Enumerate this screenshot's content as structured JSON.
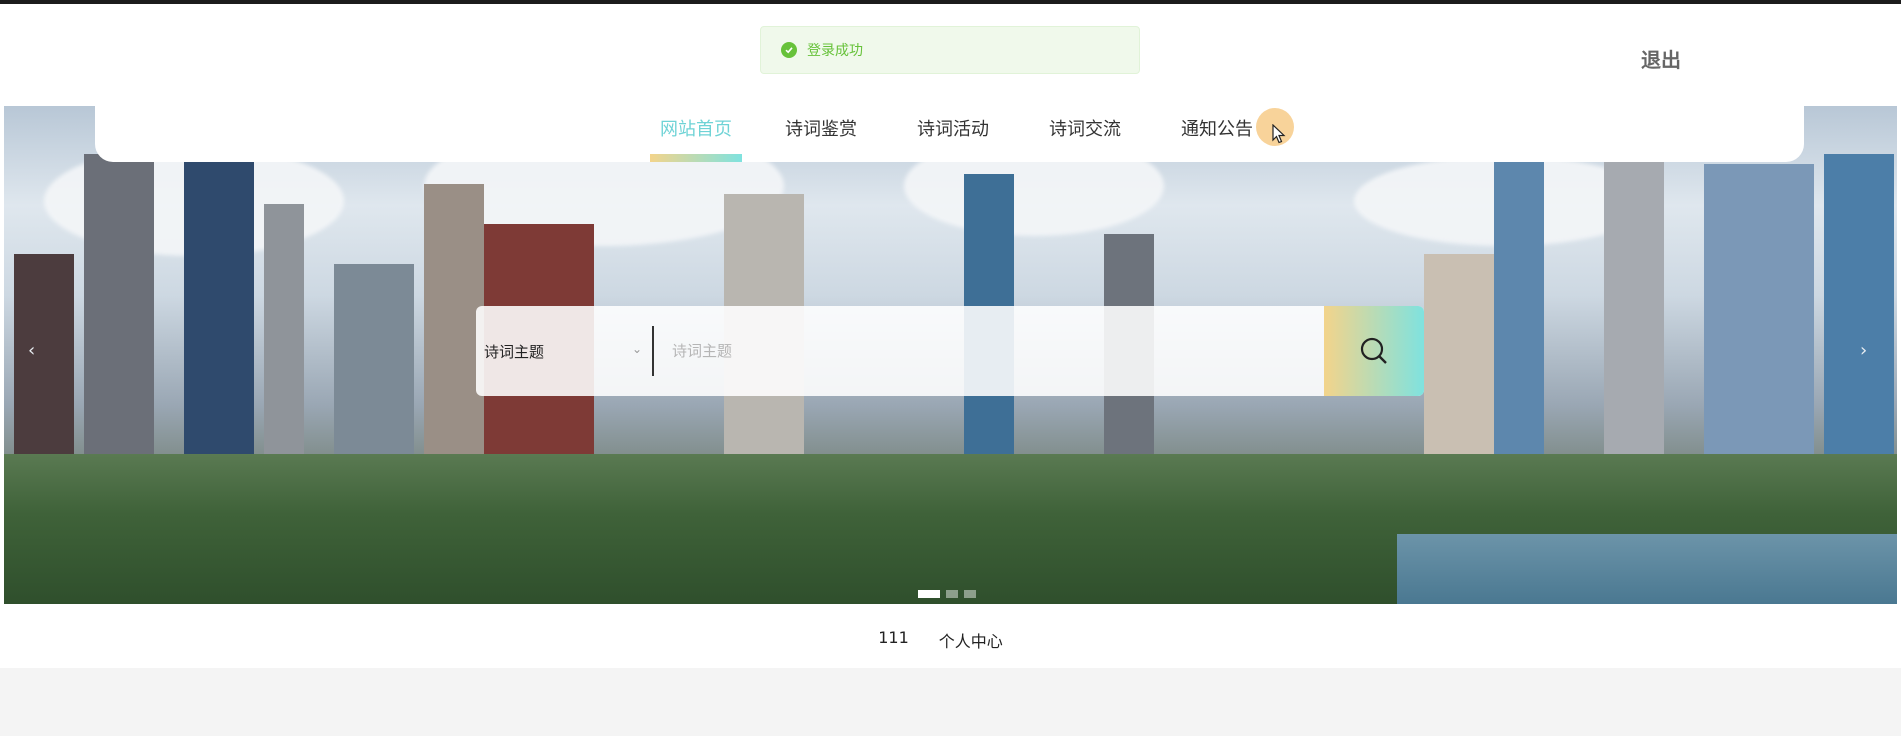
{
  "toast": {
    "message": "登录成功",
    "icon": "check-circle-icon",
    "color": "#67c23a"
  },
  "header": {
    "logout_label": "退出"
  },
  "nav": {
    "items": [
      {
        "label": "网站首页",
        "active": true
      },
      {
        "label": "诗词鉴赏",
        "active": false
      },
      {
        "label": "诗词活动",
        "active": false
      },
      {
        "label": "诗词交流",
        "active": false
      },
      {
        "label": "通知公告",
        "active": false
      }
    ],
    "accent_gradient": [
      "#f3d48b",
      "#7fe2df"
    ],
    "active_color": "#6fd3d6"
  },
  "search": {
    "category_selected": "诗词主题",
    "placeholder": "诗词主题",
    "button_icon": "search-icon"
  },
  "carousel": {
    "prev_icon": "chevron-left-icon",
    "next_icon": "chevron-right-icon",
    "slide_count": 3,
    "active_index": 0
  },
  "footer_links": {
    "username": "111",
    "profile_label": "个人中心"
  }
}
